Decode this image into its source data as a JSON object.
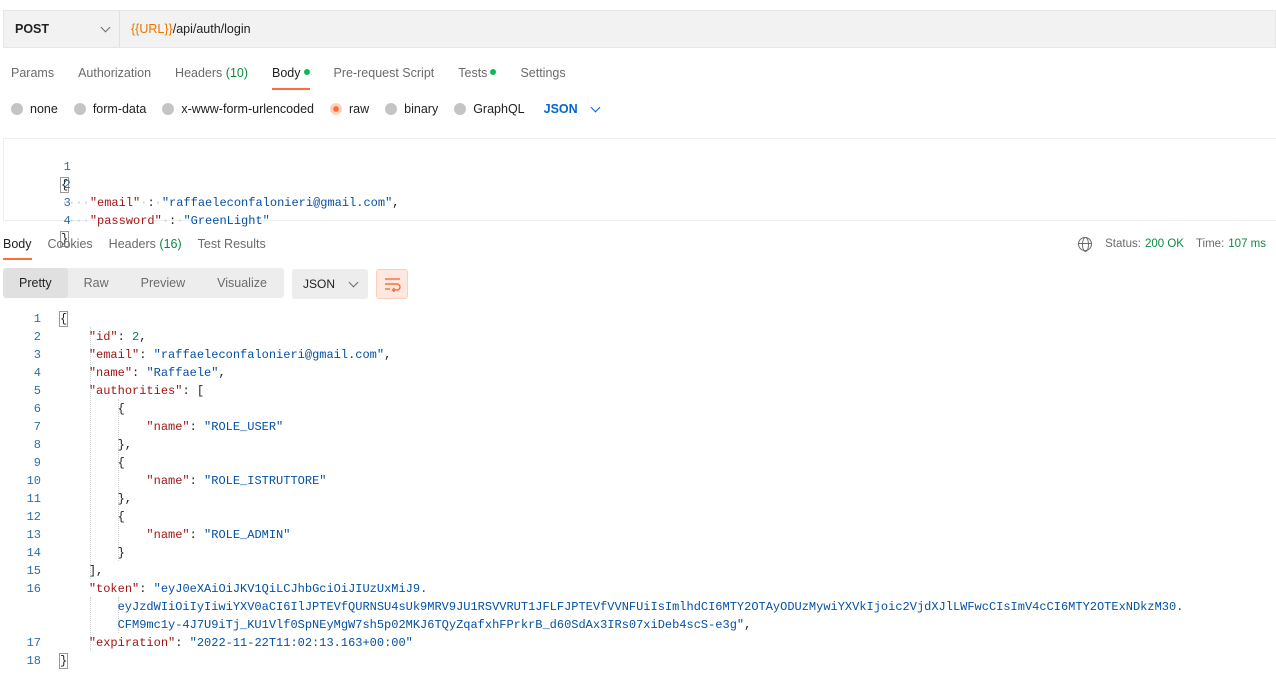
{
  "request": {
    "method": "POST",
    "url_variable": "{{URL}}",
    "url_path": "/api/auth/login"
  },
  "request_tabs": [
    {
      "label": "Params"
    },
    {
      "label": "Authorization"
    },
    {
      "label": "Headers",
      "count": "(10)"
    },
    {
      "label": "Body",
      "dot": true
    },
    {
      "label": "Pre-request Script"
    },
    {
      "label": "Tests",
      "dot": true
    },
    {
      "label": "Settings"
    }
  ],
  "body_types": [
    {
      "label": "none",
      "selected": false
    },
    {
      "label": "form-data",
      "selected": false
    },
    {
      "label": "x-www-form-urlencoded",
      "selected": false
    },
    {
      "label": "raw",
      "selected": true
    },
    {
      "label": "binary",
      "selected": false
    },
    {
      "label": "GraphQL",
      "selected": false
    }
  ],
  "raw_language": "JSON",
  "request_body": {
    "line_numbers": [
      "1",
      "2",
      "3",
      "4"
    ],
    "open_brace": "{",
    "email_key": "\"email\"",
    "email_value": "\"raffaeleconfalonieri@gmail.com\"",
    "password_key": "\"password\"",
    "password_value": "\"GreenLight\"",
    "close_brace": "}"
  },
  "response_tabs": [
    {
      "label": "Body"
    },
    {
      "label": "Cookies"
    },
    {
      "label": "Headers",
      "count": "(16)"
    },
    {
      "label": "Test Results"
    }
  ],
  "status": {
    "status_label": "Status:",
    "status_value": "200 OK",
    "time_label": "Time:",
    "time_value": "107 ms"
  },
  "view_modes": [
    "Pretty",
    "Raw",
    "Preview",
    "Visualize"
  ],
  "response_format": "JSON",
  "response_body": {
    "line_numbers": [
      "1",
      "2",
      "3",
      "4",
      "5",
      "6",
      "7",
      "8",
      "9",
      "10",
      "11",
      "12",
      "13",
      "14",
      "15",
      "16",
      "17",
      "18"
    ],
    "id_key": "\"id\"",
    "id_value": "2",
    "email_key": "\"email\"",
    "email_value": "\"raffaeleconfalonieri@gmail.com\"",
    "name_key": "\"name\"",
    "name_value": "\"Raffaele\"",
    "authorities_key": "\"authorities\"",
    "role_name_key": "\"name\"",
    "roles": [
      "\"ROLE_USER\"",
      "\"ROLE_ISTRUTTORE\"",
      "\"ROLE_ADMIN\""
    ],
    "token_key": "\"token\"",
    "token_line1": "\"eyJ0eXAiOiJKV1QiLCJhbGciOiJIUzUxMiJ9.",
    "token_line2": "eyJzdWIiOiIyIiwiYXV0aCI6IlJPTEVfQURNSU4sUk9MRV9JU1RSVVRUT1JFLFJPTEVfVVNFUiIsImlhdCI6MTY2OTAyODUzMywiYXVkIjoic2VjdXJlLWFwcCIsImV4cCI6MTY2OTExNDkzM30.",
    "token_line3": "CFM9mc1y-4J7U9iTj_KU1Vlf0SpNEyMgW7sh5p02MKJ6TQyZqafxhFPrkrB_d60SdAx3IRs07xiDeb4scS-e3g\"",
    "expiration_key": "\"expiration\"",
    "expiration_value": "\"2022-11-22T11:02:13.163+00:00\""
  }
}
